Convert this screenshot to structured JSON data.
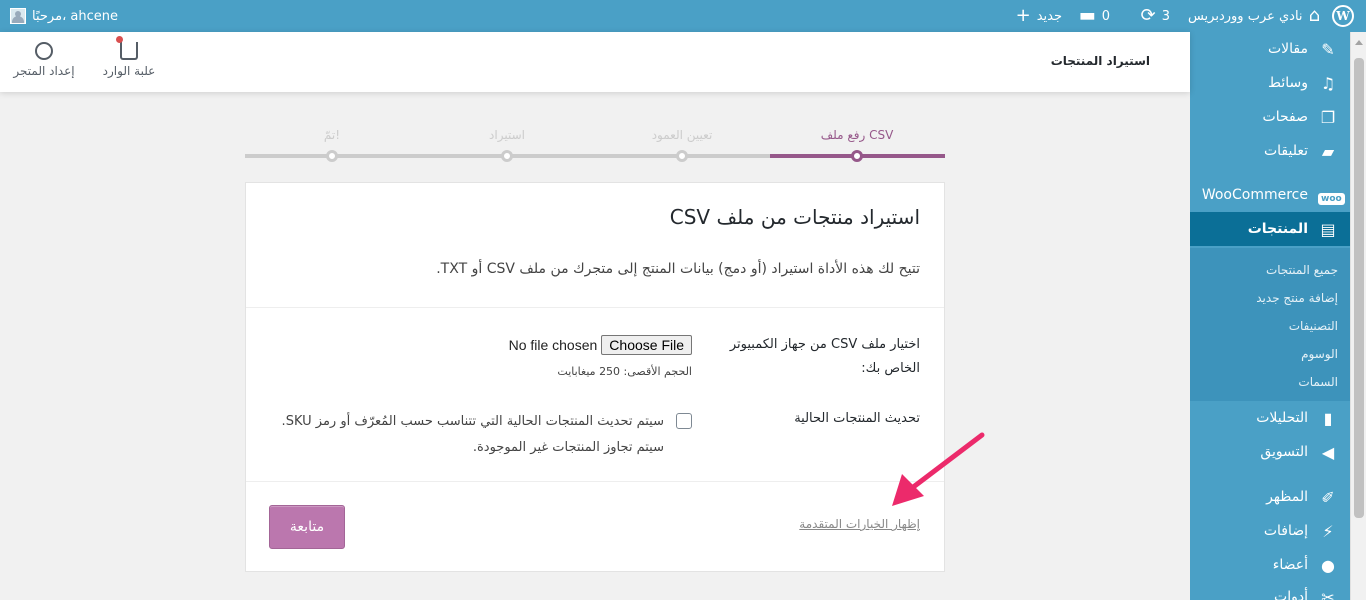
{
  "adminbar": {
    "site_name": "نادي عرب ووردبريس",
    "updates_count": "3",
    "comments_count": "0",
    "new_label": "جديد",
    "greeting": "مرحبًا، ahcene"
  },
  "sidebar": {
    "items": [
      {
        "label": "مقالات",
        "icon": "pin-icon"
      },
      {
        "label": "وسائط",
        "icon": "media-icon"
      },
      {
        "label": "صفحات",
        "icon": "pages-icon"
      },
      {
        "label": "تعليقات",
        "icon": "comments-icon"
      },
      {
        "label": "WooCommerce",
        "icon": "woo-icon",
        "badge": "woo"
      },
      {
        "label": "المنتجات",
        "icon": "archive-icon",
        "active": true
      },
      {
        "label": "التحليلات",
        "icon": "chart-icon"
      },
      {
        "label": "التسويق",
        "icon": "megaphone-icon"
      },
      {
        "label": "المظهر",
        "icon": "brush-icon"
      },
      {
        "label": "إضافات",
        "icon": "plugin-icon"
      },
      {
        "label": "أعضاء",
        "icon": "user-icon"
      },
      {
        "label": "أدوات",
        "icon": "wrench-icon"
      }
    ],
    "submenu": [
      "جميع المنتجات",
      "إضافة منتج جديد",
      "التصنيفات",
      "الوسوم",
      "السمات"
    ]
  },
  "header": {
    "page_title": "استيراد المنتجات",
    "inbox_label": "علبة الوارد",
    "setup_label": "إعداد المتجر"
  },
  "steps": [
    {
      "label": "رفع ملف CSV",
      "done": true
    },
    {
      "label": "تعيين العمود",
      "done": false
    },
    {
      "label": "استيراد",
      "done": false
    },
    {
      "label": "تمّ!",
      "done": false
    }
  ],
  "card": {
    "title": "استيراد منتجات من ملف CSV",
    "description": "تتيح لك هذه الأداة استيراد (أو دمج) بيانات المنتج إلى متجرك من ملف CSV أو TXT.",
    "file_label": "اختيار ملف CSV من جهاز الكمبيوتر الخاص بك:",
    "choose_file": "Choose File",
    "no_file": "No file chosen",
    "max_size": "الحجم الأقصى: 250 ميغابايت",
    "update_label": "تحديث المنتجات الحالية",
    "update_desc": "سيتم تحديث المنتجات الحالية التي تتناسب حسب المُعرّف أو رمز SKU. سيتم تجاوز المنتجات غير الموجودة.",
    "advanced_link": "إظهار الخيارات المتقدمة",
    "continue_button": "متابعة"
  },
  "colors": {
    "accent": "#96588a",
    "button": "#bb77ae",
    "adminbar": "#4aa0c6",
    "sidebar_active": "#0b6f97",
    "arrow": "#ec2a6b"
  }
}
